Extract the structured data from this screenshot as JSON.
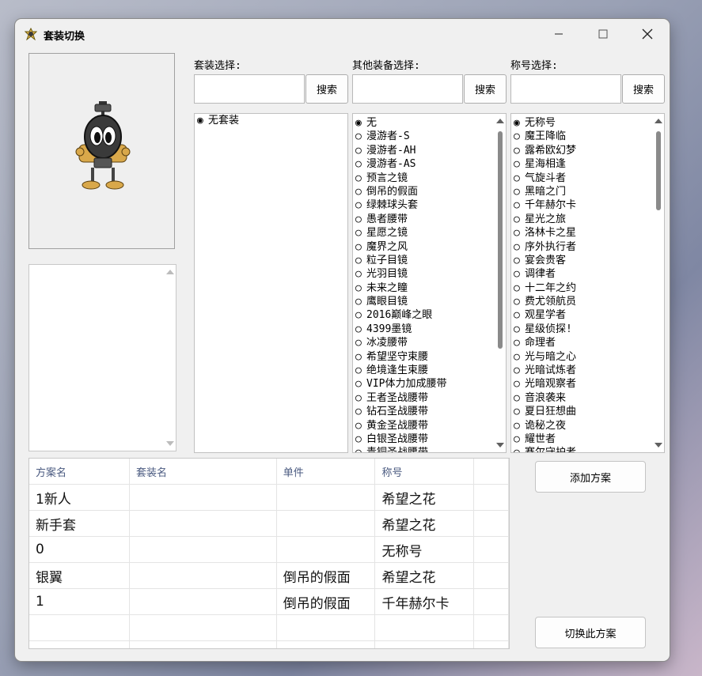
{
  "window": {
    "title": "套装切换"
  },
  "labels": {
    "suit": "套装选择:",
    "other": "其他装备选择:",
    "title": "称号选择:"
  },
  "search_label": "搜索",
  "suits": [
    {
      "label": "无套装",
      "selected": true
    }
  ],
  "equipment": [
    {
      "label": "无",
      "selected": true
    },
    {
      "label": "漫游者-S"
    },
    {
      "label": "漫游者-AH"
    },
    {
      "label": "漫游者-AS"
    },
    {
      "label": "预言之镜"
    },
    {
      "label": "倒吊的假面"
    },
    {
      "label": "绿棘球头套"
    },
    {
      "label": "愚者腰带"
    },
    {
      "label": "星愿之镜"
    },
    {
      "label": "魔界之风"
    },
    {
      "label": "粒子目镜"
    },
    {
      "label": "光羽目镜"
    },
    {
      "label": "未来之瞳"
    },
    {
      "label": "鹰眼目镜"
    },
    {
      "label": "2016巅峰之眼"
    },
    {
      "label": "4399墨镜"
    },
    {
      "label": "冰凌腰带"
    },
    {
      "label": "希望坚守束腰"
    },
    {
      "label": "绝境逢生束腰"
    },
    {
      "label": "VIP体力加成腰带"
    },
    {
      "label": "王者圣战腰带"
    },
    {
      "label": "钻石圣战腰带"
    },
    {
      "label": "黄金圣战腰带"
    },
    {
      "label": "白银圣战腰带"
    },
    {
      "label": "青铜圣战腰带"
    }
  ],
  "titles": [
    {
      "label": "无称号",
      "selected": true
    },
    {
      "label": "魔王降临"
    },
    {
      "label": "露希欧幻梦"
    },
    {
      "label": "星海相逢"
    },
    {
      "label": "气旋斗者"
    },
    {
      "label": "黑暗之门"
    },
    {
      "label": "千年赫尔卡"
    },
    {
      "label": "星光之旅"
    },
    {
      "label": "洛林卡之星"
    },
    {
      "label": "序外执行者"
    },
    {
      "label": "宴会贵客"
    },
    {
      "label": "调律者"
    },
    {
      "label": "十二年之约"
    },
    {
      "label": "费尤领航员"
    },
    {
      "label": "观星学者"
    },
    {
      "label": "星级侦探!"
    },
    {
      "label": "命理者"
    },
    {
      "label": "光与暗之心"
    },
    {
      "label": "光暗试炼者"
    },
    {
      "label": "光暗观察者"
    },
    {
      "label": "音浪袭来"
    },
    {
      "label": "夏日狂想曲"
    },
    {
      "label": "诡秘之夜"
    },
    {
      "label": "耀世者"
    },
    {
      "label": "赛尔守护者"
    }
  ],
  "table": {
    "headers": [
      "方案名",
      "套装名",
      "单件",
      "称号"
    ],
    "rows": [
      [
        "1新人",
        "",
        "",
        "希望之花"
      ],
      [
        "新手套",
        "",
        "",
        "希望之花"
      ],
      [
        "0",
        "",
        "",
        "无称号"
      ],
      [
        "银翼",
        "",
        "倒吊的假面",
        "希望之花"
      ],
      [
        "1",
        "",
        "倒吊的假面",
        "千年赫尔卡"
      ],
      [
        "",
        "",
        "",
        ""
      ],
      [
        "",
        "",
        "",
        ""
      ]
    ]
  },
  "buttons": {
    "add": "添加方案",
    "switch": "切换此方案"
  },
  "colors": {
    "accent": "#e6b84a",
    "header_text": "#4a5a80"
  }
}
